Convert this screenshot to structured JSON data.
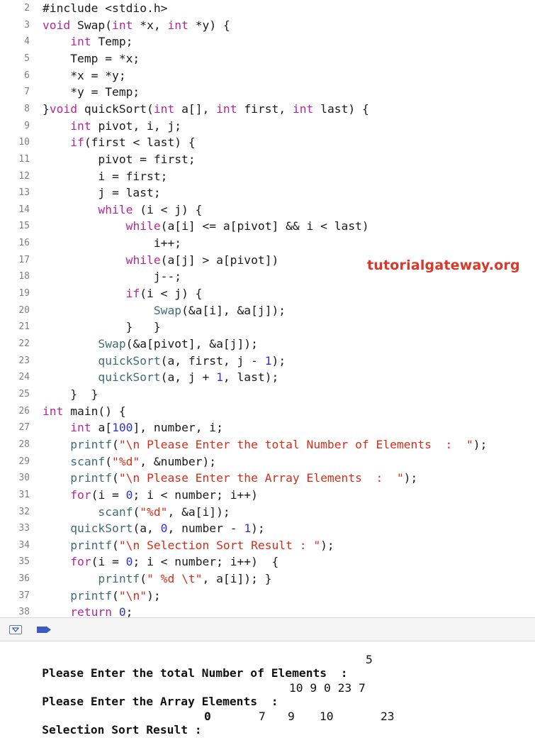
{
  "editor": {
    "lines": [
      {
        "n": "2",
        "tokens": [
          {
            "t": "#include <stdio.h>",
            "c": "plain"
          }
        ]
      },
      {
        "n": "3",
        "tokens": [
          {
            "t": "void",
            "c": "kw"
          },
          {
            "t": " Swap(",
            "c": "plain"
          },
          {
            "t": "int",
            "c": "kw"
          },
          {
            "t": " *x, ",
            "c": "plain"
          },
          {
            "t": "int",
            "c": "kw"
          },
          {
            "t": " *y) {",
            "c": "plain"
          }
        ]
      },
      {
        "n": "4",
        "tokens": [
          {
            "t": "    ",
            "c": "plain"
          },
          {
            "t": "int",
            "c": "kw"
          },
          {
            "t": " Temp;",
            "c": "plain"
          }
        ]
      },
      {
        "n": "5",
        "tokens": [
          {
            "t": "    Temp = *x;",
            "c": "plain"
          }
        ]
      },
      {
        "n": "6",
        "tokens": [
          {
            "t": "    *x = *y;",
            "c": "plain"
          }
        ]
      },
      {
        "n": "7",
        "tokens": [
          {
            "t": "    *y = Temp;",
            "c": "plain"
          }
        ]
      },
      {
        "n": "8",
        "tokens": [
          {
            "t": "}",
            "c": "plain"
          },
          {
            "t": "void",
            "c": "kw"
          },
          {
            "t": " quickSort(",
            "c": "plain"
          },
          {
            "t": "int",
            "c": "kw"
          },
          {
            "t": " a[], ",
            "c": "plain"
          },
          {
            "t": "int",
            "c": "kw"
          },
          {
            "t": " first, ",
            "c": "plain"
          },
          {
            "t": "int",
            "c": "kw"
          },
          {
            "t": " last) {",
            "c": "plain"
          }
        ]
      },
      {
        "n": "9",
        "tokens": [
          {
            "t": "    ",
            "c": "plain"
          },
          {
            "t": "int",
            "c": "kw"
          },
          {
            "t": " pivot, i, j;",
            "c": "plain"
          }
        ]
      },
      {
        "n": "10",
        "tokens": [
          {
            "t": "    ",
            "c": "plain"
          },
          {
            "t": "if",
            "c": "kw"
          },
          {
            "t": "(first < last) {",
            "c": "plain"
          }
        ]
      },
      {
        "n": "11",
        "tokens": [
          {
            "t": "        pivot = first;",
            "c": "plain"
          }
        ]
      },
      {
        "n": "12",
        "tokens": [
          {
            "t": "        i = first;",
            "c": "plain"
          }
        ]
      },
      {
        "n": "13",
        "tokens": [
          {
            "t": "        j = last;",
            "c": "plain"
          }
        ]
      },
      {
        "n": "14",
        "tokens": [
          {
            "t": "        ",
            "c": "plain"
          },
          {
            "t": "while",
            "c": "kw"
          },
          {
            "t": " (i < j) {",
            "c": "plain"
          }
        ]
      },
      {
        "n": "15",
        "tokens": [
          {
            "t": "            ",
            "c": "plain"
          },
          {
            "t": "while",
            "c": "kw"
          },
          {
            "t": "(a[i] <= a[pivot] && i < last)",
            "c": "plain"
          }
        ]
      },
      {
        "n": "16",
        "tokens": [
          {
            "t": "                i++;",
            "c": "plain"
          }
        ]
      },
      {
        "n": "17",
        "tokens": [
          {
            "t": "            ",
            "c": "plain"
          },
          {
            "t": "while",
            "c": "kw"
          },
          {
            "t": "(a[j] > a[pivot])",
            "c": "plain"
          }
        ]
      },
      {
        "n": "18",
        "tokens": [
          {
            "t": "                j--;",
            "c": "plain"
          }
        ]
      },
      {
        "n": "19",
        "tokens": [
          {
            "t": "            ",
            "c": "plain"
          },
          {
            "t": "if",
            "c": "kw"
          },
          {
            "t": "(i < j) {",
            "c": "plain"
          }
        ]
      },
      {
        "n": "20",
        "tokens": [
          {
            "t": "                ",
            "c": "plain"
          },
          {
            "t": "Swap",
            "c": "fn"
          },
          {
            "t": "(&a[i], &a[j]);",
            "c": "plain"
          }
        ]
      },
      {
        "n": "21",
        "tokens": [
          {
            "t": "            }   }",
            "c": "plain"
          }
        ]
      },
      {
        "n": "22",
        "tokens": [
          {
            "t": "        ",
            "c": "plain"
          },
          {
            "t": "Swap",
            "c": "fn"
          },
          {
            "t": "(&a[pivot], &a[j]);",
            "c": "plain"
          }
        ]
      },
      {
        "n": "23",
        "tokens": [
          {
            "t": "        ",
            "c": "plain"
          },
          {
            "t": "quickSort",
            "c": "fn"
          },
          {
            "t": "(a, first, j - ",
            "c": "plain"
          },
          {
            "t": "1",
            "c": "num"
          },
          {
            "t": ");",
            "c": "plain"
          }
        ]
      },
      {
        "n": "24",
        "tokens": [
          {
            "t": "        ",
            "c": "plain"
          },
          {
            "t": "quickSort",
            "c": "fn"
          },
          {
            "t": "(a, j + ",
            "c": "plain"
          },
          {
            "t": "1",
            "c": "num"
          },
          {
            "t": ", last);",
            "c": "plain"
          }
        ]
      },
      {
        "n": "25",
        "tokens": [
          {
            "t": "    }  }",
            "c": "plain"
          }
        ]
      },
      {
        "n": "26",
        "tokens": [
          {
            "t": "int",
            "c": "kw"
          },
          {
            "t": " main() {",
            "c": "plain"
          }
        ]
      },
      {
        "n": "27",
        "tokens": [
          {
            "t": "    ",
            "c": "plain"
          },
          {
            "t": "int",
            "c": "kw"
          },
          {
            "t": " a[",
            "c": "plain"
          },
          {
            "t": "100",
            "c": "num"
          },
          {
            "t": "], number, i;",
            "c": "plain"
          }
        ]
      },
      {
        "n": "28",
        "tokens": [
          {
            "t": "    ",
            "c": "plain"
          },
          {
            "t": "printf",
            "c": "fn"
          },
          {
            "t": "(",
            "c": "plain"
          },
          {
            "t": "\"\\n Please Enter the total Number of Elements  :  \"",
            "c": "str"
          },
          {
            "t": ");",
            "c": "plain"
          }
        ]
      },
      {
        "n": "29",
        "tokens": [
          {
            "t": "    ",
            "c": "plain"
          },
          {
            "t": "scanf",
            "c": "fn"
          },
          {
            "t": "(",
            "c": "plain"
          },
          {
            "t": "\"%d\"",
            "c": "str"
          },
          {
            "t": ", &number);",
            "c": "plain"
          }
        ]
      },
      {
        "n": "30",
        "tokens": [
          {
            "t": "    ",
            "c": "plain"
          },
          {
            "t": "printf",
            "c": "fn"
          },
          {
            "t": "(",
            "c": "plain"
          },
          {
            "t": "\"\\n Please Enter the Array Elements  :  \"",
            "c": "str"
          },
          {
            "t": ");",
            "c": "plain"
          }
        ]
      },
      {
        "n": "31",
        "tokens": [
          {
            "t": "    ",
            "c": "plain"
          },
          {
            "t": "for",
            "c": "kw"
          },
          {
            "t": "(i = ",
            "c": "plain"
          },
          {
            "t": "0",
            "c": "num"
          },
          {
            "t": "; i < number; i++)",
            "c": "plain"
          }
        ]
      },
      {
        "n": "32",
        "tokens": [
          {
            "t": "        ",
            "c": "plain"
          },
          {
            "t": "scanf",
            "c": "fn"
          },
          {
            "t": "(",
            "c": "plain"
          },
          {
            "t": "\"%d\"",
            "c": "str"
          },
          {
            "t": ", &a[i]);",
            "c": "plain"
          }
        ]
      },
      {
        "n": "33",
        "tokens": [
          {
            "t": "    ",
            "c": "plain"
          },
          {
            "t": "quickSort",
            "c": "fn"
          },
          {
            "t": "(a, ",
            "c": "plain"
          },
          {
            "t": "0",
            "c": "num"
          },
          {
            "t": ", number - ",
            "c": "plain"
          },
          {
            "t": "1",
            "c": "num"
          },
          {
            "t": ");",
            "c": "plain"
          }
        ]
      },
      {
        "n": "34",
        "tokens": [
          {
            "t": "    ",
            "c": "plain"
          },
          {
            "t": "printf",
            "c": "fn"
          },
          {
            "t": "(",
            "c": "plain"
          },
          {
            "t": "\"\\n Selection Sort Result : \"",
            "c": "str"
          },
          {
            "t": ");",
            "c": "plain"
          }
        ]
      },
      {
        "n": "35",
        "tokens": [
          {
            "t": "    ",
            "c": "plain"
          },
          {
            "t": "for",
            "c": "kw"
          },
          {
            "t": "(i = ",
            "c": "plain"
          },
          {
            "t": "0",
            "c": "num"
          },
          {
            "t": "; i < number; i++)  {",
            "c": "plain"
          }
        ]
      },
      {
        "n": "36",
        "tokens": [
          {
            "t": "        ",
            "c": "plain"
          },
          {
            "t": "printf",
            "c": "fn"
          },
          {
            "t": "(",
            "c": "plain"
          },
          {
            "t": "\" %d \\t\"",
            "c": "str"
          },
          {
            "t": ", a[i]); }",
            "c": "plain"
          }
        ]
      },
      {
        "n": "37",
        "tokens": [
          {
            "t": "    ",
            "c": "plain"
          },
          {
            "t": "printf",
            "c": "fn"
          },
          {
            "t": "(",
            "c": "plain"
          },
          {
            "t": "\"\\n\"",
            "c": "str"
          },
          {
            "t": ");",
            "c": "plain"
          }
        ]
      },
      {
        "n": "38",
        "tokens": [
          {
            "t": "    ",
            "c": "plain"
          },
          {
            "t": "return",
            "c": "kw"
          },
          {
            "t": " ",
            "c": "plain"
          },
          {
            "t": "0",
            "c": "num"
          },
          {
            "t": ";",
            "c": "plain"
          }
        ]
      }
    ]
  },
  "watermark": {
    "text": "tutorialgateway.org"
  },
  "debug_bar": {
    "toggle_icon": "hide-debug-area-icon",
    "breakpoint_icon": "breakpoint-icon",
    "accent_color": "#3a5bbf"
  },
  "console": {
    "line1_label": "Please Enter the total Number of Elements  :",
    "line1_value": "5",
    "line2_label": "Please Enter the Array Elements  :",
    "line2_value": "10 9 0 23 7",
    "line3_label": "Selection Sort Result :",
    "line3_values": [
      "0",
      "7",
      "9",
      "10",
      "23"
    ]
  },
  "colors": {
    "keyword": "#b3279b",
    "string": "#d12f1b",
    "number": "#2f36c8",
    "function": "#3e6d74",
    "watermark": "#d9382a"
  }
}
